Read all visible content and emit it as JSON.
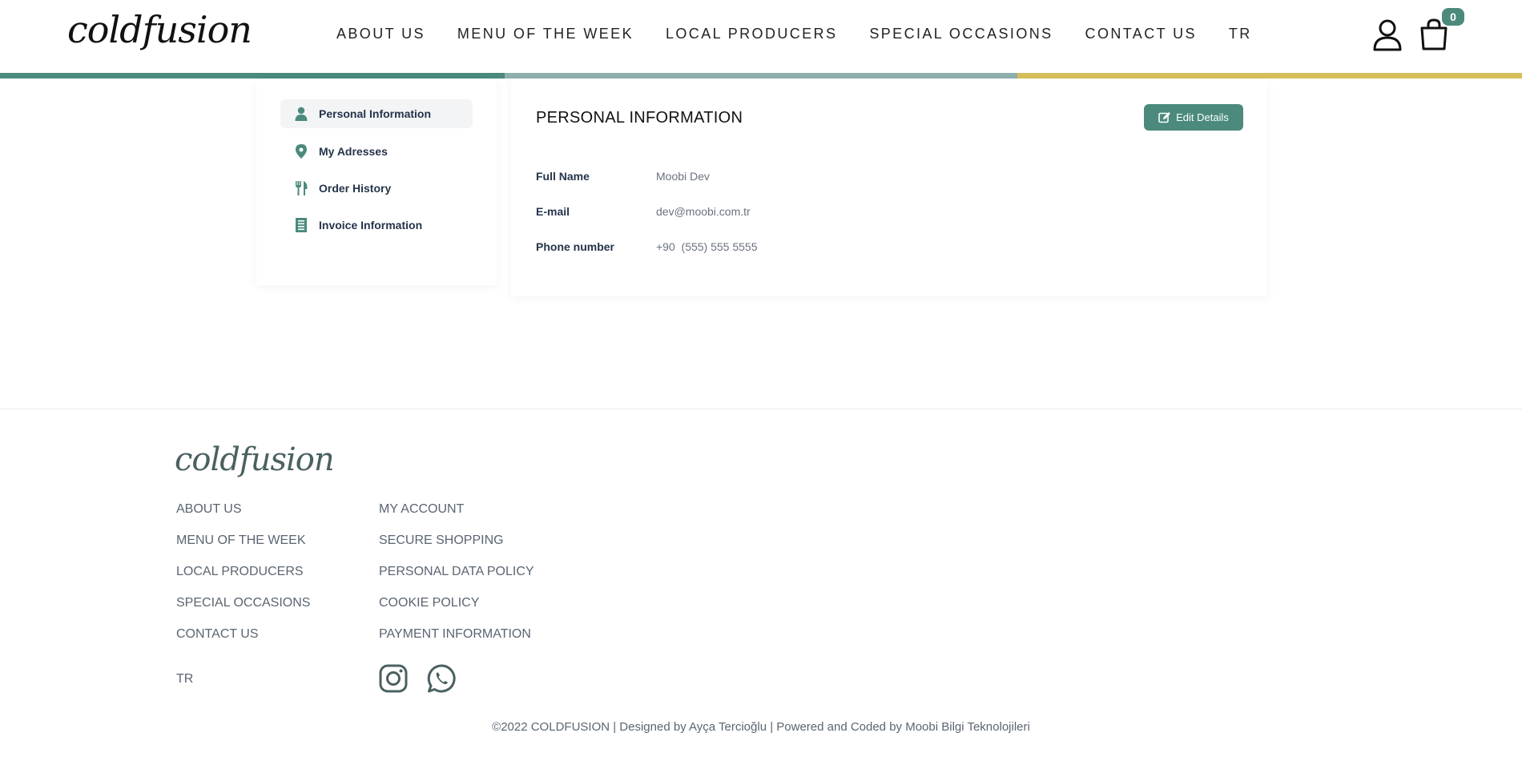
{
  "header": {
    "logo": "coldfusion",
    "nav": [
      "ABOUT US",
      "MENU OF THE WEEK",
      "LOCAL PRODUCERS",
      "SPECIAL OCCASIONS",
      "CONTACT US",
      "TR"
    ],
    "cart_count": "0"
  },
  "colors": {
    "accent": "#4b8a7d",
    "stripe_mid": "#8fb0ad",
    "stripe_gold": "#d4bf5a"
  },
  "sidebar": {
    "items": [
      {
        "label": "Personal Information",
        "icon": "user-icon",
        "active": true
      },
      {
        "label": "My Adresses",
        "icon": "map-pin-icon",
        "active": false
      },
      {
        "label": "Order History",
        "icon": "utensils-icon",
        "active": false
      },
      {
        "label": "Invoice Information",
        "icon": "receipt-icon",
        "active": false
      }
    ]
  },
  "main": {
    "title": "PERSONAL INFORMATION",
    "edit_label": "Edit Details",
    "fields": [
      {
        "label": "Full Name",
        "value": "Moobi Dev"
      },
      {
        "label": "E-mail",
        "value": "dev@moobi.com.tr"
      },
      {
        "label": "Phone number",
        "value": "+90  (555) 555 5555"
      }
    ]
  },
  "footer": {
    "logo": "coldfusion",
    "col1": [
      "ABOUT US",
      "MENU OF THE WEEK",
      "LOCAL PRODUCERS",
      "SPECIAL OCCASIONS",
      "CONTACT US"
    ],
    "col2": [
      "MY ACCOUNT",
      "SECURE SHOPPING",
      "PERSONAL DATA POLICY",
      "COOKIE POLICY",
      "PAYMENT INFORMATION"
    ],
    "lang": "TR",
    "social": [
      "instagram-icon",
      "whatsapp-icon"
    ],
    "copyright": "©2022 COLDFUSION | Designed by Ayça Tercioğlu | Powered and Coded by Moobi Bilgi Teknolojileri"
  }
}
